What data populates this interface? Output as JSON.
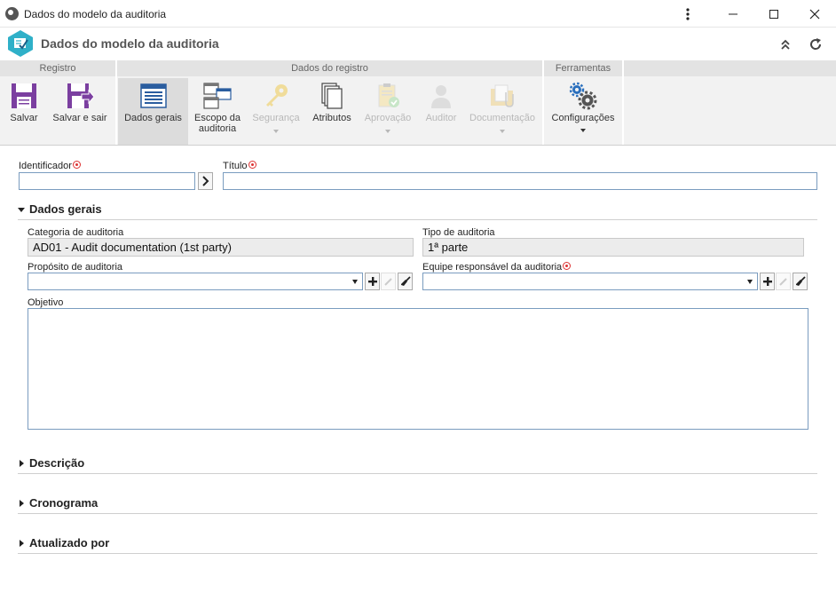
{
  "window": {
    "title": "Dados do modelo da auditoria",
    "more_icon": "more-vertical-icon",
    "minimize_icon": "minimize-icon",
    "maximize_icon": "maximize-icon",
    "close_icon": "close-icon"
  },
  "header": {
    "title": "Dados do modelo da auditoria",
    "collapse_icon": "double-chevron-up-icon",
    "refresh_icon": "refresh-icon"
  },
  "ribbon": {
    "groups": [
      {
        "title": "Registro"
      },
      {
        "title": "Dados do registro"
      },
      {
        "title": "Ferramentas"
      }
    ],
    "buttons": {
      "save": "Salvar",
      "save_exit": "Salvar e sair",
      "general": "Dados gerais",
      "scope_line1": "Escopo da",
      "scope_line2": "auditoria",
      "security": "Segurança",
      "attributes": "Atributos",
      "approval": "Aprovação",
      "auditor": "Auditor",
      "documentation": "Documentação",
      "settings": "Configurações"
    },
    "colors": {
      "purple": "#7b3fa0",
      "active_bg": "#dcdcdc",
      "gear_blue": "#2a6fbd"
    }
  },
  "form": {
    "identifier_label": "Identificador",
    "identifier_value": "",
    "title_label": "Título",
    "title_value": "",
    "sections": {
      "general": "Dados gerais",
      "description": "Descrição",
      "schedule": "Cronograma",
      "updated_by": "Atualizado por"
    },
    "category_label": "Categoria de auditoria",
    "category_value": "AD01 - Audit documentation (1st party)",
    "type_label": "Tipo de auditoria",
    "type_value": "1ª parte",
    "purpose_label": "Propósito de auditoria",
    "purpose_value": "",
    "team_label": "Equipe responsável da auditoria",
    "team_value": "",
    "objective_label": "Objetivo",
    "objective_value": ""
  }
}
